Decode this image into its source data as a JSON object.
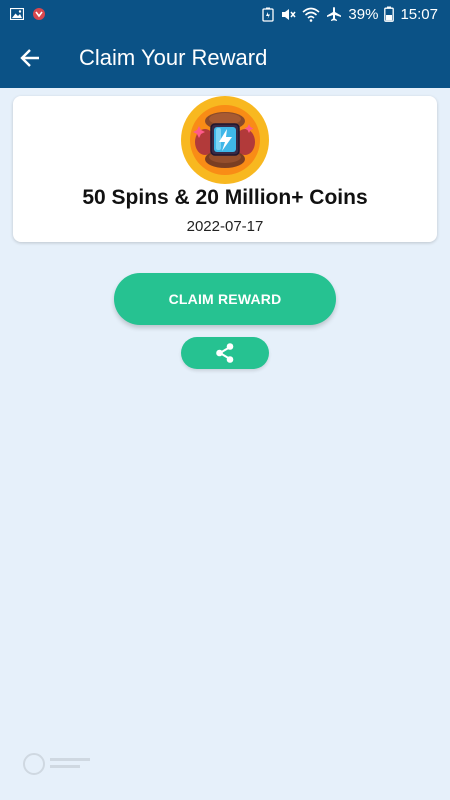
{
  "status_bar": {
    "battery_percent": "39%",
    "time": "15:07",
    "left_icons": [
      "image-icon",
      "notification-app-icon"
    ],
    "right_icons": [
      "battery-saver-icon",
      "mute-icon",
      "wifi-icon",
      "airplane-icon",
      "battery-icon"
    ]
  },
  "app_bar": {
    "title": "Claim Your Reward",
    "back_icon": "arrow-back-icon",
    "background": "#0b5286"
  },
  "reward": {
    "icon": "energy-capsule-icon",
    "title": "50 Spins & 20 Million+ Coins",
    "date": "2022-07-17"
  },
  "actions": {
    "claim_label": "CLAIM REWARD",
    "share_icon": "share-icon",
    "button_color": "#26c291"
  },
  "page": {
    "background": "#e6f0fa"
  }
}
